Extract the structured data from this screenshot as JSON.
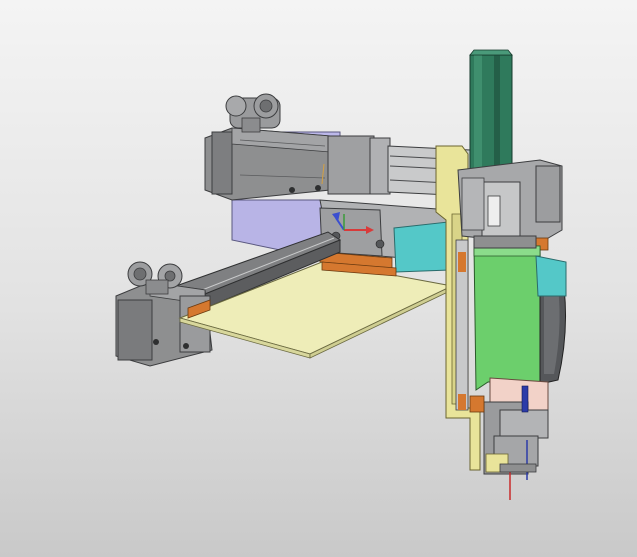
{
  "viewport": {
    "background_top": "#f4f4f4",
    "background_bottom": "#c9c9c9"
  },
  "colors": {
    "motor_gray": "#8e8f90",
    "motor_dark": "#4a4b4d",
    "base_plate_cream": "#eeedb8",
    "frame_yellow": "#e9e49a",
    "carriage_green": "#6ccf6c",
    "column_teal": "#2f7a5c",
    "block_cyan": "#54c8c8",
    "base_lavender": "#b8b4e6",
    "edge_orange": "#d5782f",
    "tool_pink": "#f2d2c8",
    "axis_x": "#d83a3a",
    "axis_y": "#3a9a3a",
    "axis_z": "#3b4fd0"
  },
  "icons": {
    "triad": "axis-triad-icon"
  }
}
